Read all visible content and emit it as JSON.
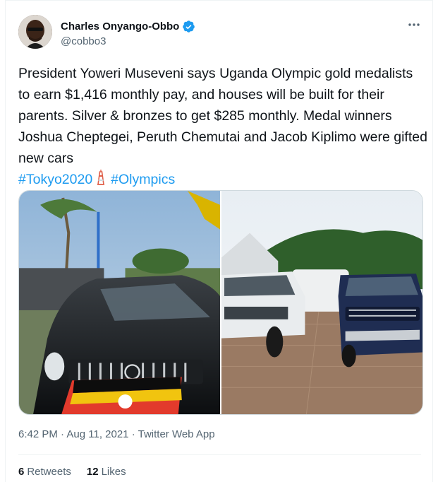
{
  "author": {
    "display_name": "Charles Onyango-Obbo",
    "handle": "@cobbo3",
    "verified_icon": "verified-badge-icon"
  },
  "tweet": {
    "text_main": "President Yoweri Museveni says Uganda Olympic gold medalists to earn $1,416 monthly pay, and houses will be built for their parents. Silver & bronzes to get $285 monthly. Medal winners Joshua Cheptegei, Peruth Chemutai and Jacob Kiplimo were gifted new cars",
    "hashtag_1": "#Tokyo2020",
    "hashtag_2": "#Olympics",
    "emoji_icon": "tokyo-tower-icon"
  },
  "meta": {
    "time": "6:42 PM",
    "separator": "·",
    "date": "Aug 11, 2021",
    "source": "Twitter Web App"
  },
  "stats": {
    "retweets_count": "6",
    "retweets_label": "Retweets",
    "likes_count": "12",
    "likes_label": "Likes"
  },
  "colors": {
    "link": "#1d9bf0",
    "secondary_text": "#536471",
    "primary_text": "#0f1419"
  }
}
